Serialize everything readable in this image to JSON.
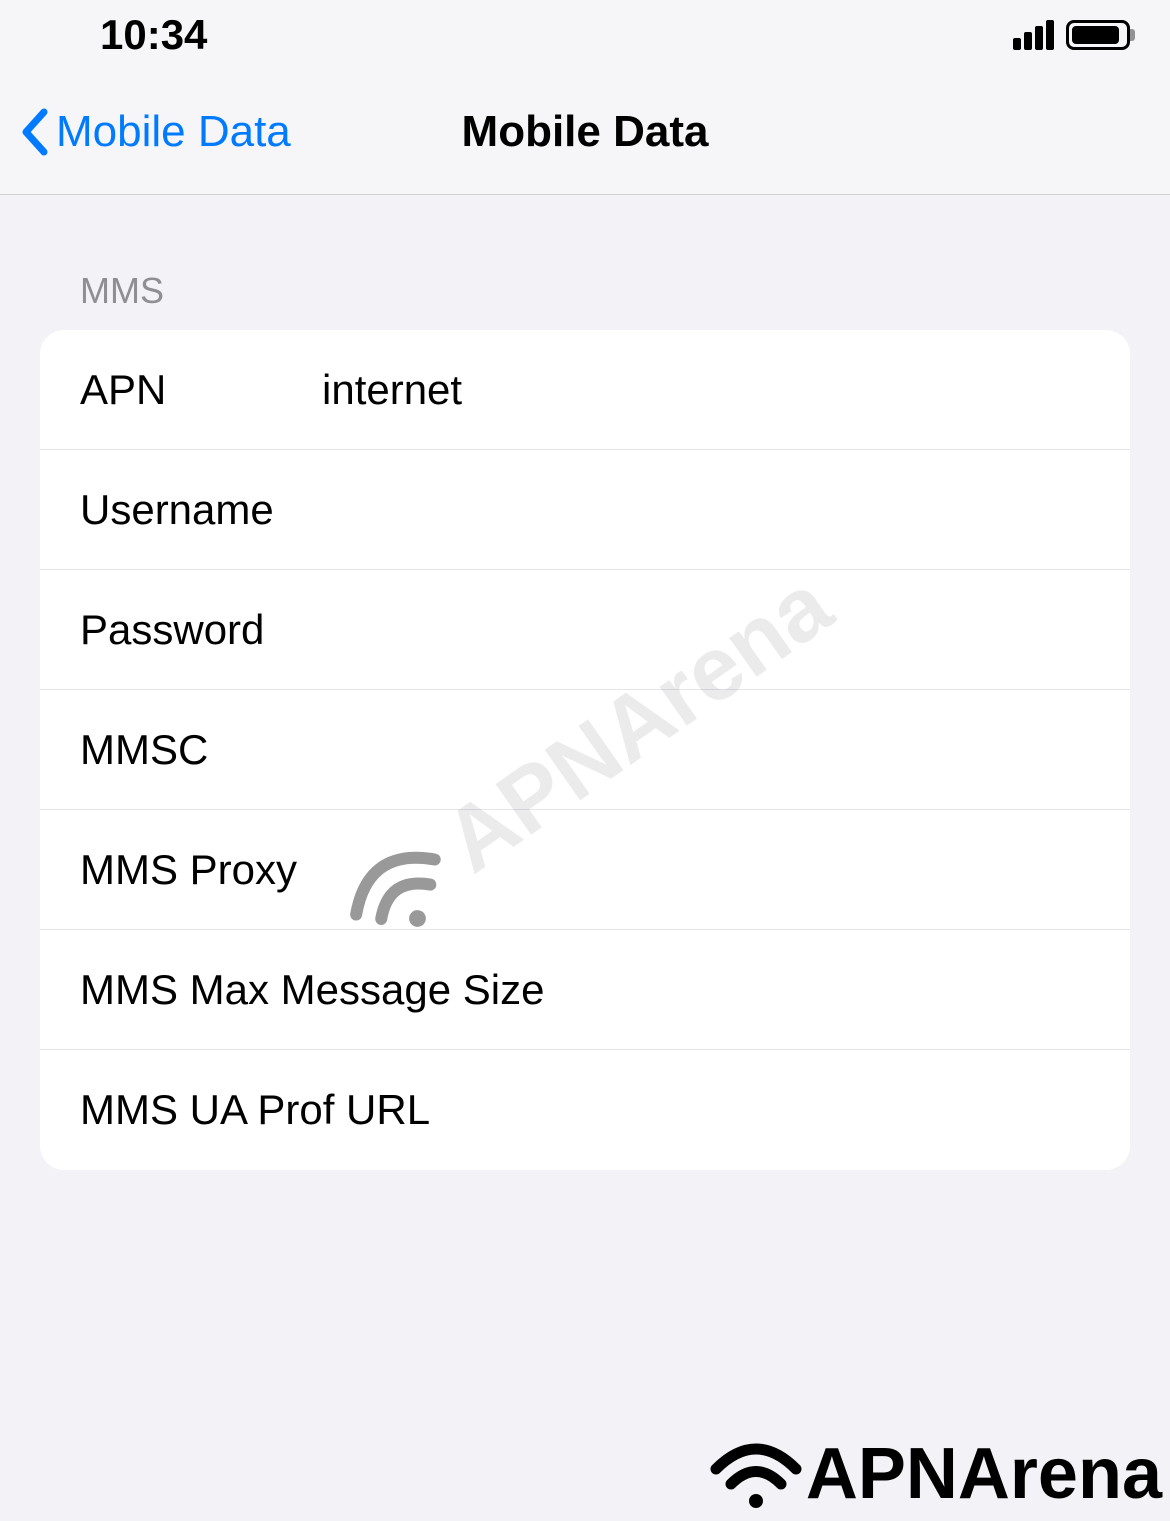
{
  "status_bar": {
    "time": "10:34"
  },
  "nav": {
    "back_label": "Mobile Data",
    "title": "Mobile Data"
  },
  "section": {
    "header": "MMS"
  },
  "fields": {
    "apn": {
      "label": "APN",
      "value": "internet"
    },
    "username": {
      "label": "Username",
      "value": ""
    },
    "password": {
      "label": "Password",
      "value": ""
    },
    "mmsc": {
      "label": "MMSC",
      "value": ""
    },
    "mms_proxy": {
      "label": "MMS Proxy",
      "value": ""
    },
    "mms_max_size": {
      "label": "MMS Max Message Size",
      "value": ""
    },
    "mms_ua_prof": {
      "label": "MMS UA Prof URL",
      "value": ""
    }
  },
  "watermark": {
    "text": "APNArena"
  },
  "footer": {
    "text": "APNArena"
  }
}
